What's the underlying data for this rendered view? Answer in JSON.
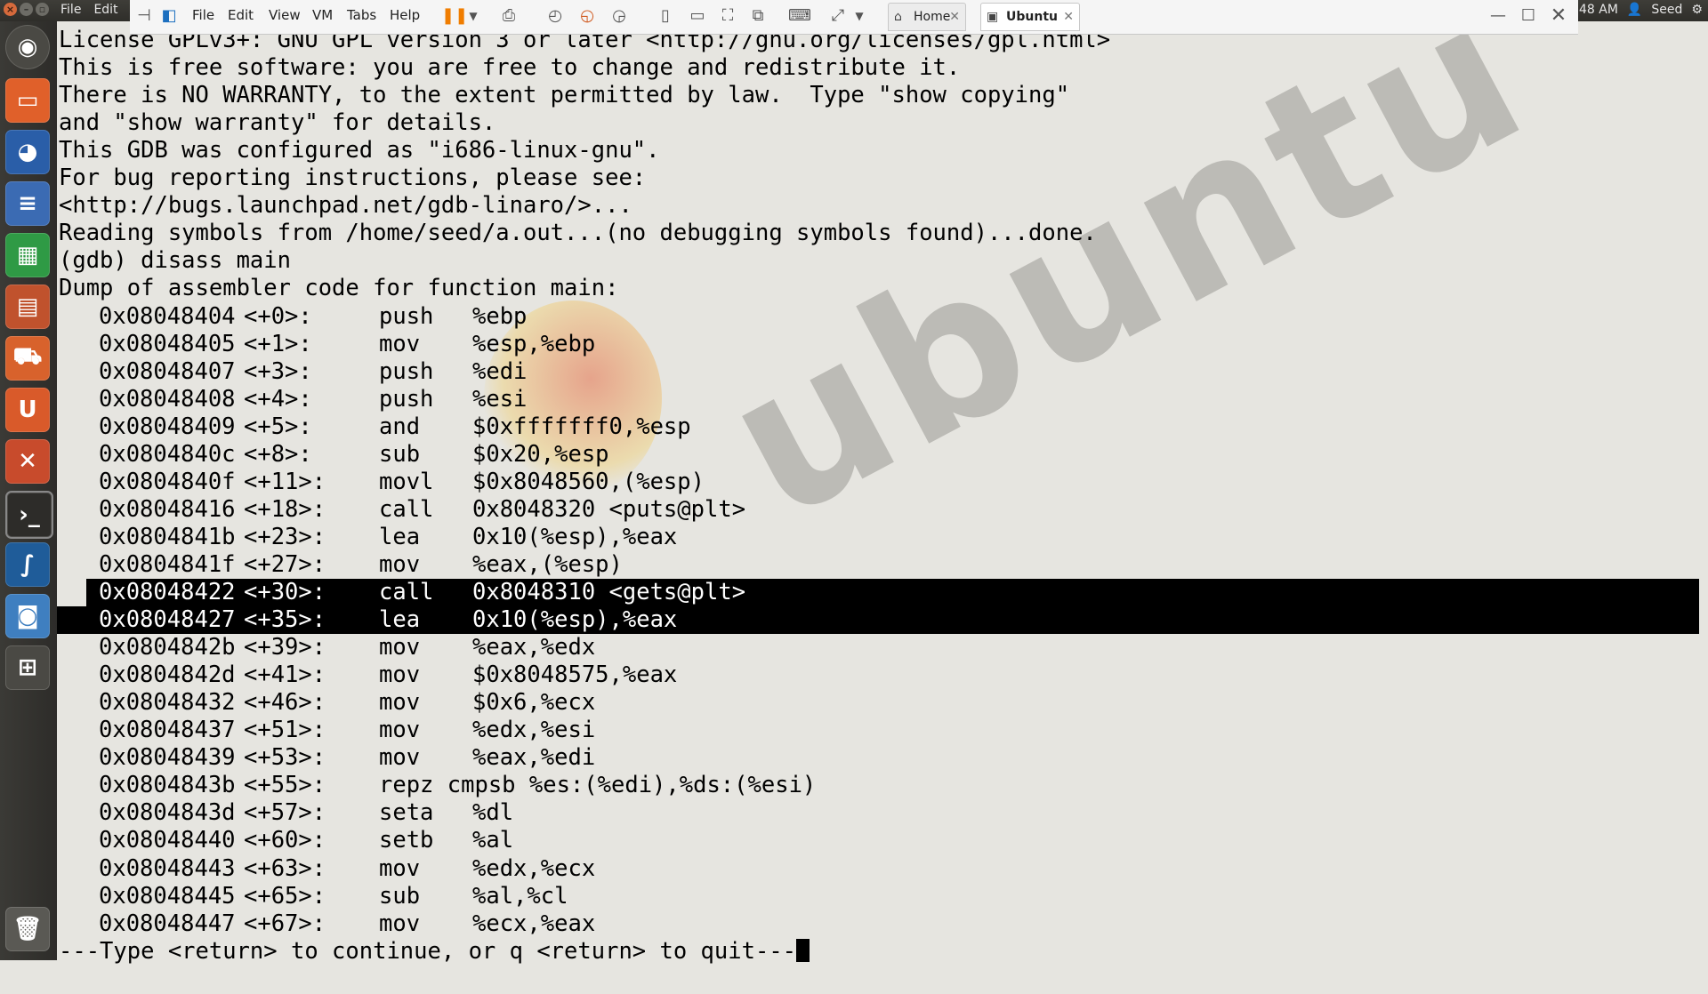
{
  "top_panel": {
    "menus": [
      "File",
      "Edit"
    ],
    "time": "48 AM",
    "user": "Seed"
  },
  "vm_toolbar": {
    "menus": [
      "File",
      "Edit",
      "View",
      "VM",
      "Tabs",
      "Help"
    ],
    "tabs": [
      {
        "label": "Home",
        "active": false
      },
      {
        "label": "Ubuntu",
        "active": true
      }
    ]
  },
  "launcher": {
    "items": [
      "dash-icon",
      "files-icon",
      "firefox-icon",
      "writer-icon",
      "calc-icon",
      "impress-icon",
      "software-center-icon",
      "ubuntu-one-icon",
      "settings-icon",
      "terminal-icon",
      "wireshark-icon",
      "screenshot-icon",
      "workspace-icon",
      "trash-icon"
    ]
  },
  "terminal": {
    "watermark": "ubuntu",
    "header_lines": [
      "License GPLv3+: GNU GPL version 3 or later <http://gnu.org/licenses/gpl.html>",
      "This is free software: you are free to change and redistribute it.",
      "There is NO WARRANTY, to the extent permitted by law.  Type \"show copying\"",
      "and \"show warranty\" for details.",
      "This GDB was configured as \"i686-linux-gnu\".",
      "For bug reporting instructions, please see:",
      "<http://bugs.launchpad.net/gdb-linaro/>...",
      "Reading symbols from /home/seed/a.out...(no debugging symbols found)...done.",
      "(gdb) disass main",
      "Dump of assembler code for function main:"
    ],
    "asm": [
      {
        "addr": "0x08048404",
        "off": "<+0>:",
        "op": "push",
        "arg": "%ebp"
      },
      {
        "addr": "0x08048405",
        "off": "<+1>:",
        "op": "mov",
        "arg": "%esp,%ebp"
      },
      {
        "addr": "0x08048407",
        "off": "<+3>:",
        "op": "push",
        "arg": "%edi"
      },
      {
        "addr": "0x08048408",
        "off": "<+4>:",
        "op": "push",
        "arg": "%esi"
      },
      {
        "addr": "0x08048409",
        "off": "<+5>:",
        "op": "and",
        "arg": "$0xfffffff0,%esp"
      },
      {
        "addr": "0x0804840c",
        "off": "<+8>:",
        "op": "sub",
        "arg": "$0x20,%esp"
      },
      {
        "addr": "0x0804840f",
        "off": "<+11>:",
        "op": "movl",
        "arg": "$0x8048560,(%esp)"
      },
      {
        "addr": "0x08048416",
        "off": "<+18>:",
        "op": "call",
        "arg": "0x8048320 <puts@plt>"
      },
      {
        "addr": "0x0804841b",
        "off": "<+23>:",
        "op": "lea",
        "arg": "0x10(%esp),%eax"
      },
      {
        "addr": "0x0804841f",
        "off": "<+27>:",
        "op": "mov",
        "arg": "%eax,(%esp)"
      },
      {
        "addr": "0x08048422",
        "off": "<+30>:",
        "op": "call",
        "arg": "0x8048310 <gets@plt>",
        "selected": true
      },
      {
        "addr": "0x08048427",
        "off": "<+35>:",
        "op": "lea",
        "arg": "0x10(%esp),%eax",
        "selected": true
      },
      {
        "addr": "0x0804842b",
        "off": "<+39>:",
        "op": "mov",
        "arg": "%eax,%edx"
      },
      {
        "addr": "0x0804842d",
        "off": "<+41>:",
        "op": "mov",
        "arg": "$0x8048575,%eax"
      },
      {
        "addr": "0x08048432",
        "off": "<+46>:",
        "op": "mov",
        "arg": "$0x6,%ecx"
      },
      {
        "addr": "0x08048437",
        "off": "<+51>:",
        "op": "mov",
        "arg": "%edx,%esi"
      },
      {
        "addr": "0x08048439",
        "off": "<+53>:",
        "op": "mov",
        "arg": "%eax,%edi"
      },
      {
        "addr": "0x0804843b",
        "off": "<+55>:",
        "op": "repz cmpsb %es:(%edi),%ds:(%esi)",
        "arg": ""
      },
      {
        "addr": "0x0804843d",
        "off": "<+57>:",
        "op": "seta",
        "arg": "%dl"
      },
      {
        "addr": "0x08048440",
        "off": "<+60>:",
        "op": "setb",
        "arg": "%al"
      },
      {
        "addr": "0x08048443",
        "off": "<+63>:",
        "op": "mov",
        "arg": "%edx,%ecx"
      },
      {
        "addr": "0x08048445",
        "off": "<+65>:",
        "op": "sub",
        "arg": "%al,%cl"
      },
      {
        "addr": "0x08048447",
        "off": "<+67>:",
        "op": "mov",
        "arg": "%ecx,%eax"
      }
    ],
    "prompt": "---Type <return> to continue, or q <return> to quit---"
  }
}
